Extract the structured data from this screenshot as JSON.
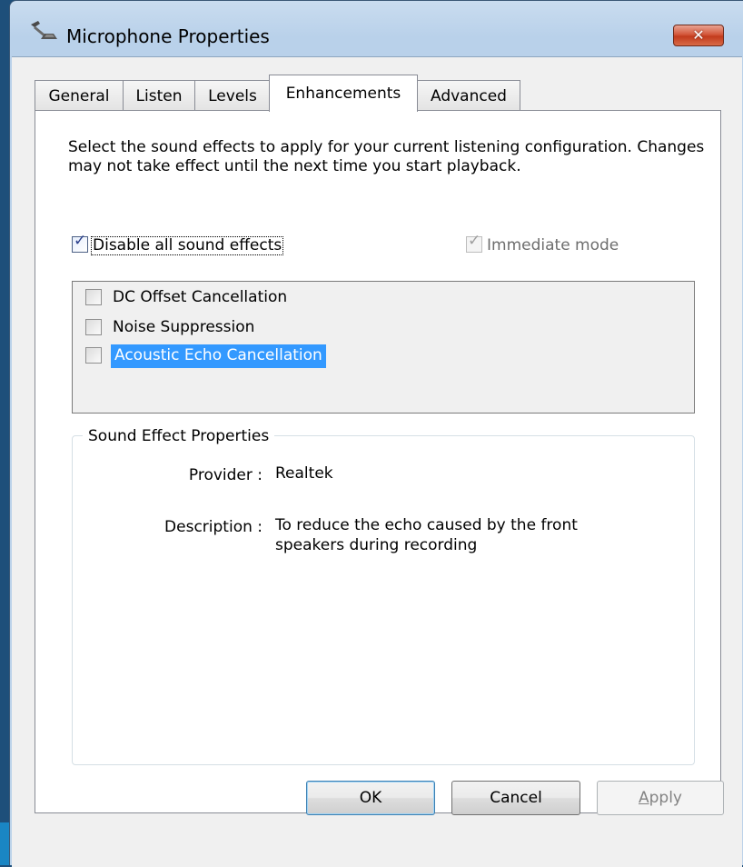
{
  "window": {
    "title": "Microphone Properties",
    "close_symbol": "✕"
  },
  "tabs": [
    {
      "label": "General",
      "active": false
    },
    {
      "label": "Listen",
      "active": false
    },
    {
      "label": "Levels",
      "active": false
    },
    {
      "label": "Enhancements",
      "active": true
    },
    {
      "label": "Advanced",
      "active": false
    }
  ],
  "panel": {
    "intro_text": "Select the sound effects to apply for your current listening configuration. Changes may not take effect until the next time you start playback.",
    "disable_all": {
      "label": "Disable all sound effects",
      "checked": true
    },
    "immediate_mode": {
      "label": "Immediate mode",
      "checked": true,
      "enabled": false
    },
    "effects": [
      {
        "label": "DC Offset Cancellation",
        "checked": false,
        "selected": false
      },
      {
        "label": "Noise Suppression",
        "checked": false,
        "selected": false
      },
      {
        "label": "Acoustic Echo Cancellation",
        "checked": false,
        "selected": true
      }
    ],
    "properties_group": {
      "title": "Sound Effect Properties",
      "provider_key": "Provider :",
      "provider_value": "Realtek",
      "description_key": "Description :",
      "description_value_line1": "To reduce the echo caused by the front",
      "description_value_line2": "speakers during recording"
    }
  },
  "buttons": {
    "ok": "OK",
    "cancel": "Cancel",
    "apply_first": "A",
    "apply_rest": "pply"
  },
  "checkmark": "✓"
}
